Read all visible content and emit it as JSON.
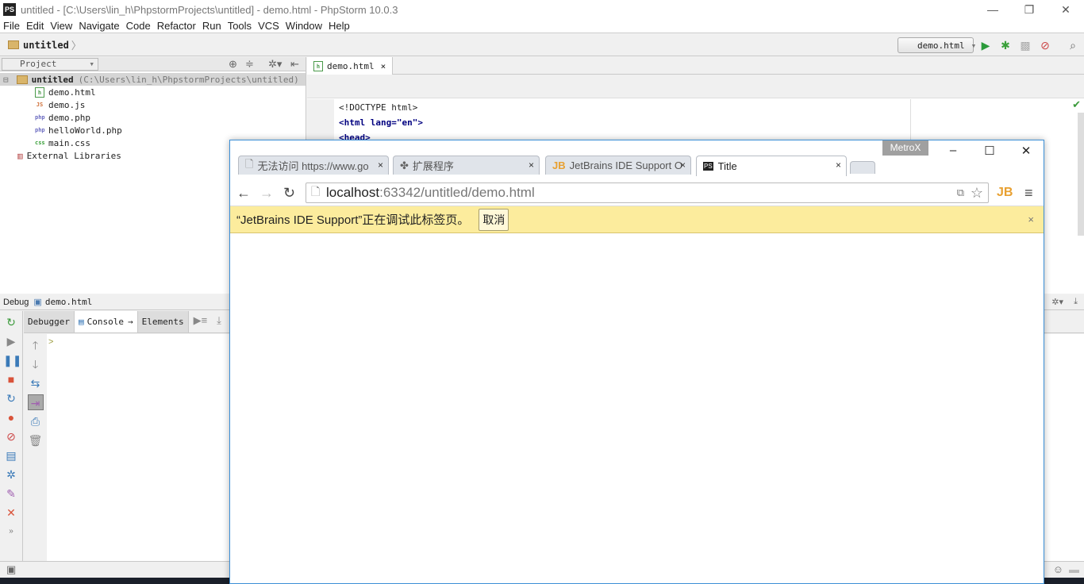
{
  "window": {
    "title": "untitled - [C:\\Users\\lin_h\\PhpstormProjects\\untitled] - demo.html - PhpStorm 10.0.3",
    "logo": "PS"
  },
  "menu": [
    "File",
    "Edit",
    "View",
    "Navigate",
    "Code",
    "Refactor",
    "Run",
    "Tools",
    "VCS",
    "Window",
    "Help"
  ],
  "navbar": {
    "crumb": "untitled",
    "run_config": "demo.html"
  },
  "project": {
    "selector": "Project",
    "root": "untitled",
    "root_path": "(C:\\Users\\lin_h\\PhpstormProjects\\untitled)",
    "files": [
      {
        "name": "demo.html",
        "badge": "h",
        "color": "#4a9a4a"
      },
      {
        "name": "demo.js",
        "badge": "JS",
        "color": "#d0703a"
      },
      {
        "name": "demo.php",
        "badge": "php",
        "color": "#6a6ac0"
      },
      {
        "name": "helloWorld.php",
        "badge": "php",
        "color": "#6a6ac0"
      },
      {
        "name": "main.css",
        "badge": "css",
        "color": "#3aa03a"
      }
    ],
    "external": "External Libraries"
  },
  "editor": {
    "tab": "demo.html",
    "lines": [
      "<!DOCTYPE html>",
      "<html lang=\"en\">",
      "<head>"
    ]
  },
  "debug": {
    "label": "Debug",
    "config": "demo.html",
    "tabs": [
      "Debugger",
      "Console",
      "Elements"
    ],
    "prompt": ">"
  },
  "chrome": {
    "badge": "MetroX",
    "tabs": [
      {
        "title": "无法访问 https://www.go"
      },
      {
        "title": "扩展程序"
      },
      {
        "title": "JetBrains IDE Support O"
      },
      {
        "title": "Title"
      }
    ],
    "url_host": "localhost",
    "url_rest": ":63342/untitled/demo.html",
    "infobar": "“JetBrains IDE Support”正在调试此标签页。",
    "cancel": "取消"
  }
}
